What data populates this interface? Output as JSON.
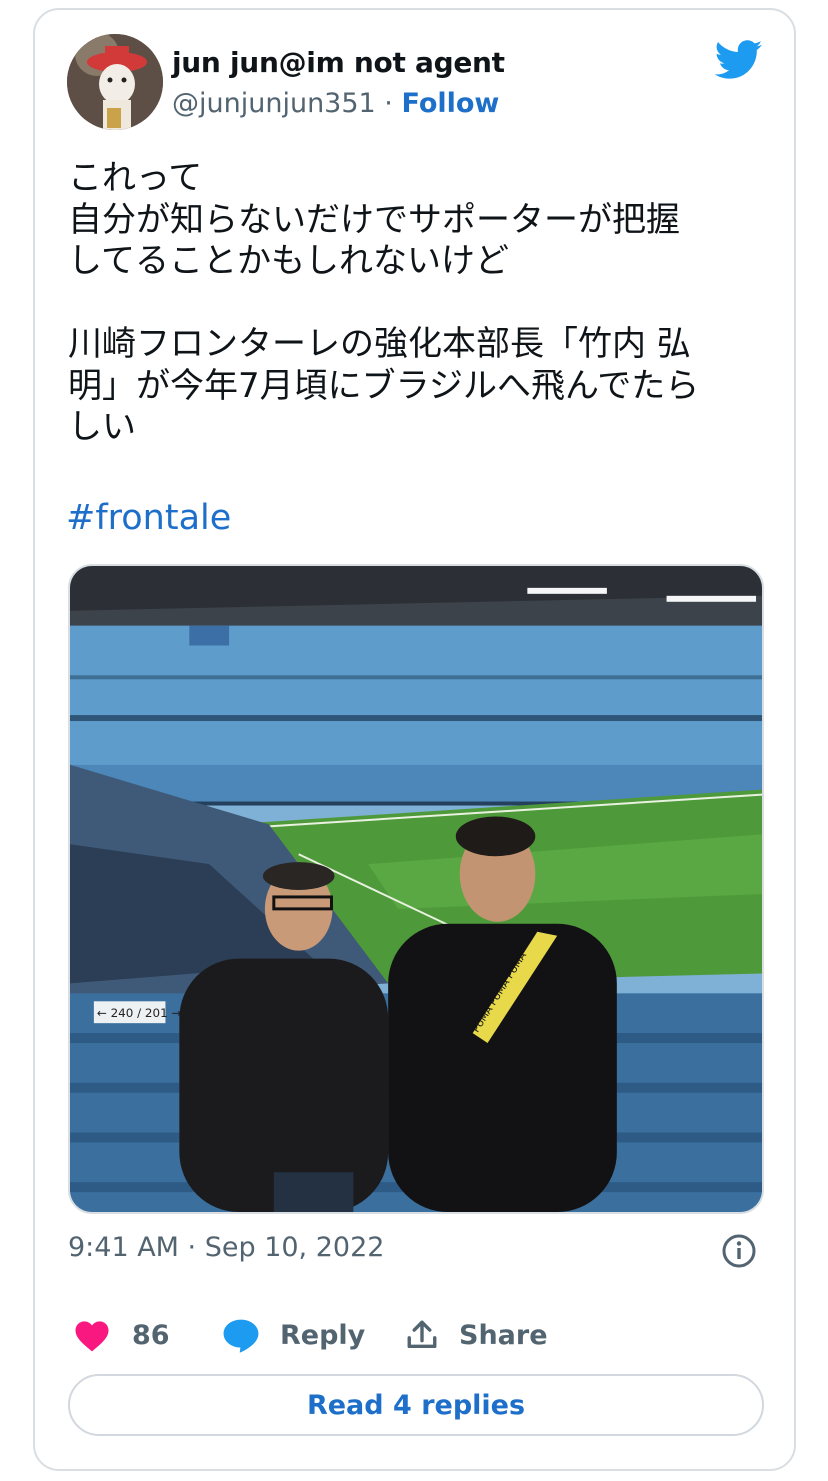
{
  "tweet": {
    "author_name": "jun jun@im not agent",
    "handle": "@junjunjun351",
    "separator": " · ",
    "follow_label": "Follow",
    "text": "これって\n自分が知らないだけでサポーターが把握\nしてることかもしれないけど\n\n川崎フロンターレの強化本部長「竹内 弘\n明」が今年7月頃にブラジルへ飛んでたら\nしい",
    "hashtag": "#frontale",
    "timestamp": "9:41 AM · Sep 10, 2022"
  },
  "photo": {
    "stand_sign": "← 240 / 201 →",
    "jacket_text": "PUMA PUMA PUMA"
  },
  "actions": {
    "like_count": "86",
    "reply_label": "Reply",
    "share_label": "Share"
  },
  "read_replies_label": "Read 4 replies",
  "colors": {
    "link_blue": "#1d6fc9",
    "twitter_blue": "#1d9bf0",
    "like_pink": "#f91880",
    "muted_text": "#536471",
    "pitch_green": "#4e9a3a",
    "stand_blue": "#5e9ccb"
  },
  "icons": [
    "twitter-bird-icon",
    "info-icon",
    "heart-icon",
    "reply-bubble-icon",
    "share-icon"
  ]
}
